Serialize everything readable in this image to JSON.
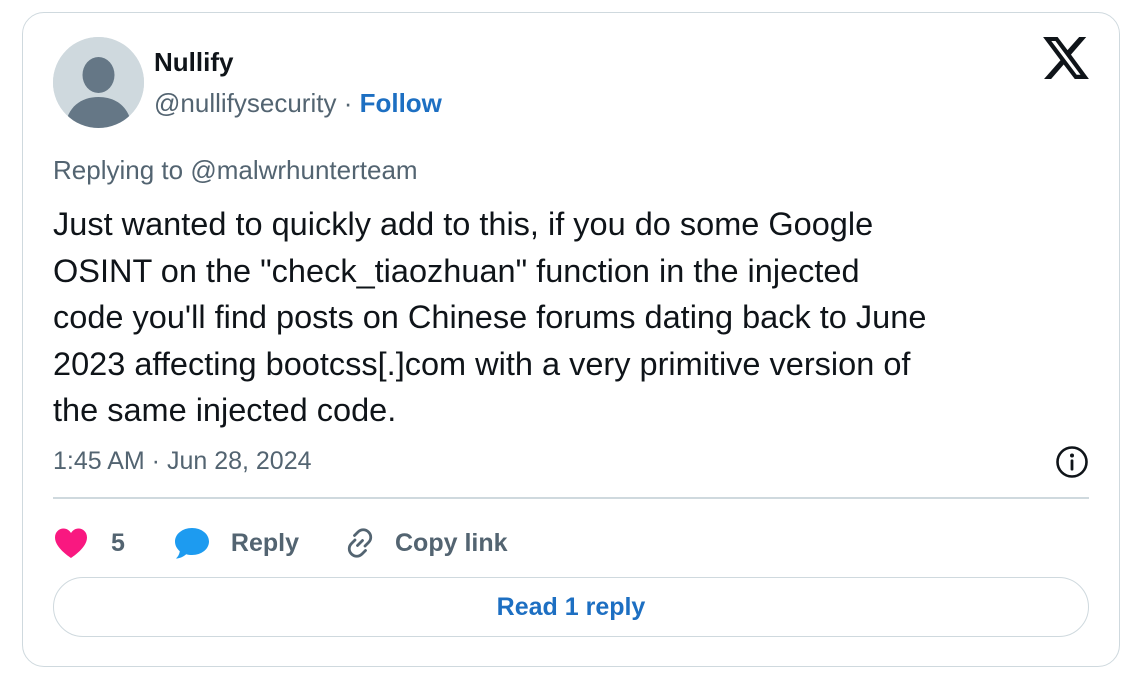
{
  "author": {
    "name": "Nullify",
    "handle": "@nullifysecurity",
    "separator": "·",
    "follow_label": "Follow"
  },
  "reply_context": {
    "prefix": "Replying to",
    "mention": "@malwrhunterteam"
  },
  "tweet": {
    "text": "Just wanted to quickly add to this, if you do some Google\nOSINT on the \"check_tiaozhuan\" function in the injected\ncode you'll find posts on Chinese forums dating back to June\n2023 affecting bootcss[.]com with a very primitive version of\nthe same injected code.",
    "timestamp": "1:45 AM · Jun 28, 2024"
  },
  "actions": {
    "like_count": "5",
    "reply_label": "Reply",
    "copy_link_label": "Copy link",
    "read_replies_label": "Read 1 reply"
  },
  "icons": {
    "brand": "x-logo-icon",
    "info": "info-icon",
    "like": "heart-icon",
    "reply": "speech-bubble-icon",
    "copy": "link-icon",
    "avatar": "default-avatar-icon"
  },
  "colors": {
    "heart": "#f91880",
    "reply_bubble": "#1d9bf0",
    "link_blue": "#1d6fc2",
    "secondary_text": "#536471",
    "border": "#cfd9de"
  }
}
